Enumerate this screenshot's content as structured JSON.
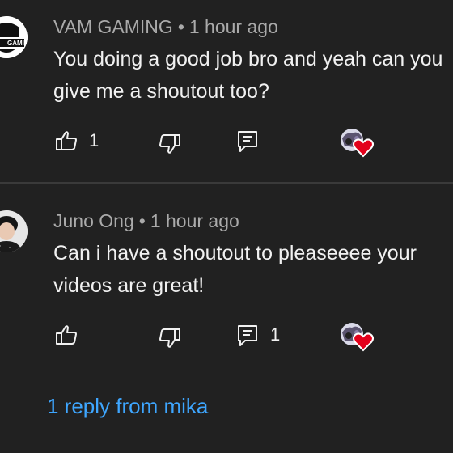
{
  "comments": [
    {
      "author": "VAM GAMING",
      "separator": "•",
      "time": "1 hour ago",
      "avatar_text": "GAMING",
      "lines": [
        "You doing a good job bro and yeah can you",
        "give me a shoutout too?"
      ],
      "like_count": "1",
      "reply_count": ""
    },
    {
      "author": "Juno Ong",
      "separator": "•",
      "time": "1 hour ago",
      "lines": [
        "Can i have a shoutout to pleaseeee your",
        "videos are great!"
      ],
      "like_count": "",
      "reply_count": "1"
    }
  ],
  "replies_link": "1 reply from mika",
  "icons": {
    "like": "thumbs-up-icon",
    "dislike": "thumbs-down-icon",
    "reply": "reply-comment-icon",
    "heart": "creator-heart-icon"
  },
  "colors": {
    "background": "#212121",
    "meta_text": "#aaaaaa",
    "link": "#3ea6ff",
    "heart": "#e3001b"
  }
}
